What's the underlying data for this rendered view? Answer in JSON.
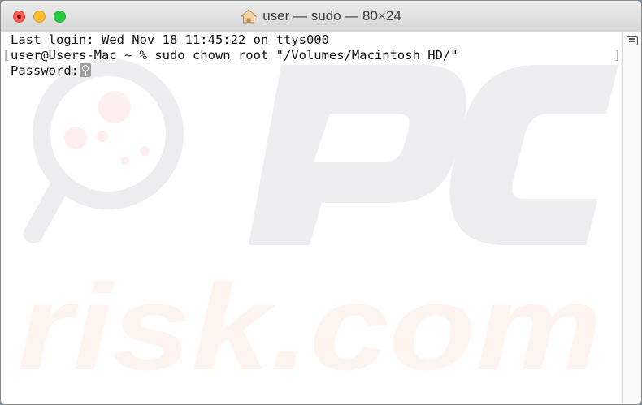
{
  "window": {
    "title": "user — sudo — 80×24",
    "title_icon": "home-icon",
    "colors": {
      "close": "#fc5f57",
      "minimize": "#fdbc2e",
      "maximize": "#28c840"
    }
  },
  "terminal": {
    "lines": [
      "Last login: Wed Nov 18 11:45:22 on ttys000",
      "user@Users-Mac ~ % sudo chown root \"/Volumes/Macintosh HD/\"",
      "Password:"
    ],
    "cursor_icon": "key-icon",
    "bracket_left": "[",
    "bracket_right": "]"
  },
  "watermark": {
    "logo_text": "PC",
    "site_text": "risk.com"
  },
  "scrollbar": {
    "marks_icon": "bookmarks-icon"
  }
}
